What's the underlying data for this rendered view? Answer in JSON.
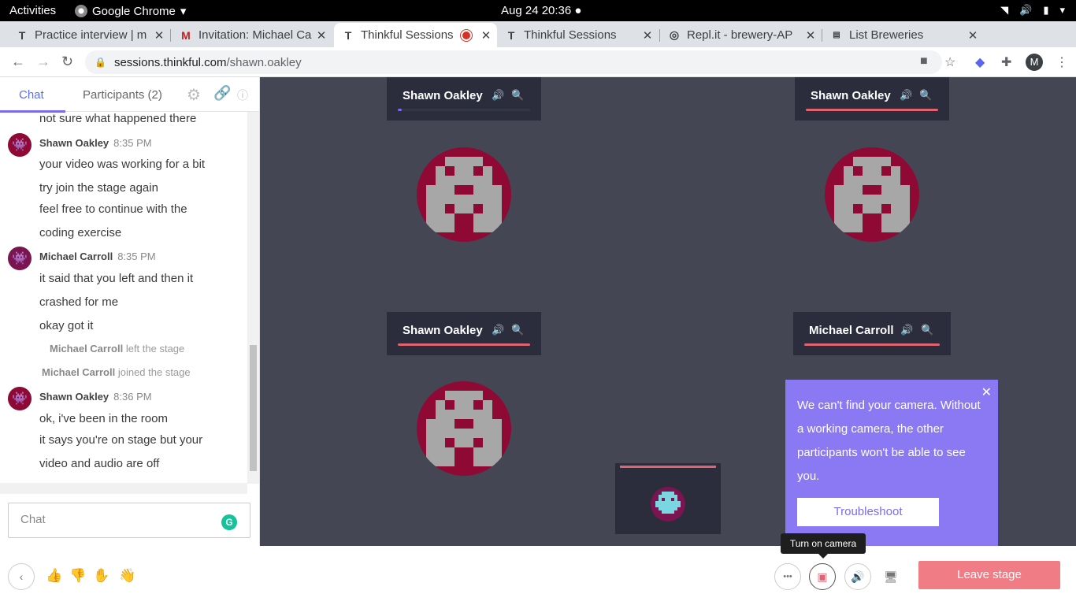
{
  "os_bar": {
    "activities": "Activities",
    "app_name": "Google Chrome",
    "clock": "Aug 24  20:36"
  },
  "tabs": [
    {
      "label": "Practice interview | m",
      "favicon": "thinkful-icon"
    },
    {
      "label": "Invitation: Michael Ca",
      "favicon": "gmail-icon"
    },
    {
      "label": "Thinkful Sessions",
      "favicon": "thinkful-icon",
      "active": true,
      "recording": true
    },
    {
      "label": "Thinkful Sessions",
      "favicon": "thinkful-icon"
    },
    {
      "label": "Repl.it - brewery-AP",
      "favicon": "replit-icon"
    },
    {
      "label": "List Breweries",
      "favicon": "page-icon"
    }
  ],
  "address": {
    "host": "sessions.thinkful.com",
    "path": "/shawn.oakley",
    "profile_initial": "M"
  },
  "chat": {
    "tab_chat": "Chat",
    "tab_participants": "Participants (2)",
    "input_placeholder": "Chat",
    "messages": {
      "prev_line": "not sure what happened there",
      "m1_author": "Shawn Oakley",
      "m1_time": "8:35 PM",
      "m1_lines": [
        "your video was working for a bit",
        "try join the stage again",
        "feel free to continue with the",
        "coding exercise"
      ],
      "m2_author": "Michael Carroll",
      "m2_time": "8:35 PM",
      "m2_lines": [
        "it said that you left and then it",
        "crashed for me",
        "okay got it"
      ],
      "sys1_name": "Michael Carroll",
      "sys1_text": "left the stage",
      "sys2_name": "Michael Carroll",
      "sys2_text": "joined the stage",
      "m3_author": "Shawn Oakley",
      "m3_time": "8:36 PM",
      "m3_lines": [
        "ok, i've been in the room",
        "it says you're on stage but your",
        "video and audio are off"
      ]
    }
  },
  "stage": {
    "tiles": [
      {
        "name": "Shawn Oakley",
        "audio": "speaker-icon"
      },
      {
        "name": "Shawn Oakley",
        "audio": "speaker-muted-icon"
      },
      {
        "name": "Shawn Oakley",
        "audio": "speaker-muted-icon"
      },
      {
        "name": "Michael Carroll",
        "audio": "speaker-muted-icon"
      }
    ],
    "camera_popover": {
      "message": "We can't find your camera. Without a working camera, the other participants won't be able to see you.",
      "button": "Troubleshoot"
    },
    "tooltip": "Turn on camera"
  },
  "bottom_bar": {
    "leave_label": "Leave stage"
  },
  "colors": {
    "accent": "#7a6cf0",
    "stage_bg": "#444654",
    "muted_red": "#e06470",
    "leave_btn": "#f07c86",
    "avatar_red": "#8e0a34"
  }
}
